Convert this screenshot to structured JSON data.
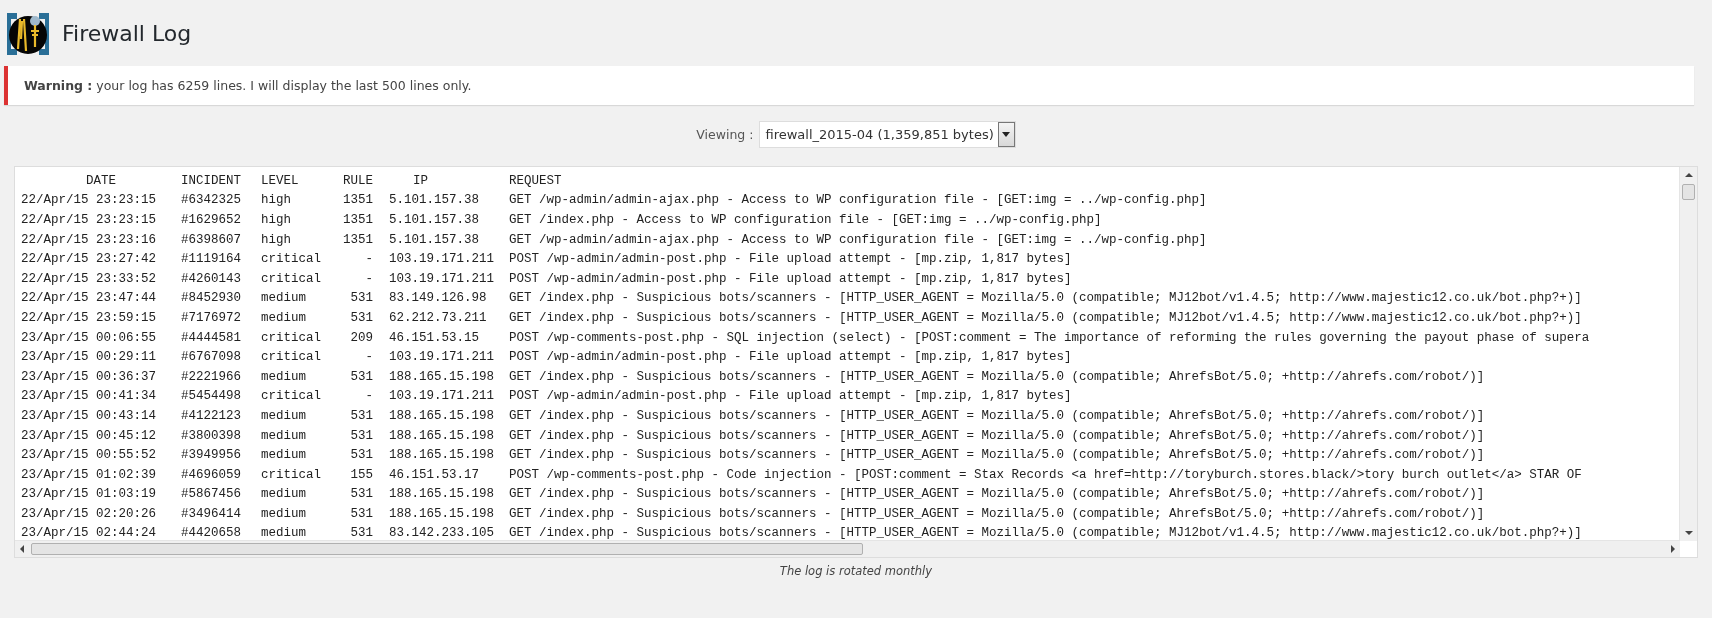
{
  "page": {
    "title": "Firewall Log"
  },
  "notice": {
    "label": "Warning :",
    "text": "your log has 6259 lines. I will display the last 500 lines only."
  },
  "viewer": {
    "label": "Viewing :",
    "value": "firewall_2015-04 (1,359,851 bytes)"
  },
  "log": {
    "columns": [
      "DATE",
      "INCIDENT",
      "LEVEL",
      "RULE",
      "IP",
      "REQUEST"
    ],
    "rows": [
      {
        "date": "22/Apr/15 23:23:15",
        "incident": "#6342325",
        "level": "high",
        "rule": "1351",
        "ip": "5.101.157.38",
        "request": "GET /wp-admin/admin-ajax.php - Access to WP configuration file - [GET:img = ../wp-config.php]"
      },
      {
        "date": "22/Apr/15 23:23:15",
        "incident": "#1629652",
        "level": "high",
        "rule": "1351",
        "ip": "5.101.157.38",
        "request": "GET /index.php - Access to WP configuration file - [GET:img = ../wp-config.php]"
      },
      {
        "date": "22/Apr/15 23:23:16",
        "incident": "#6398607",
        "level": "high",
        "rule": "1351",
        "ip": "5.101.157.38",
        "request": "GET /wp-admin/admin-ajax.php - Access to WP configuration file - [GET:img = ../wp-config.php]"
      },
      {
        "date": "22/Apr/15 23:27:42",
        "incident": "#1119164",
        "level": "critical",
        "rule": "-",
        "ip": "103.19.171.211",
        "request": "POST /wp-admin/admin-post.php - File upload attempt - [mp.zip, 1,817 bytes]"
      },
      {
        "date": "22/Apr/15 23:33:52",
        "incident": "#4260143",
        "level": "critical",
        "rule": "-",
        "ip": "103.19.171.211",
        "request": "POST /wp-admin/admin-post.php - File upload attempt - [mp.zip, 1,817 bytes]"
      },
      {
        "date": "22/Apr/15 23:47:44",
        "incident": "#8452930",
        "level": "medium",
        "rule": "531",
        "ip": "83.149.126.98",
        "request": "GET /index.php - Suspicious bots/scanners - [HTTP_USER_AGENT = Mozilla/5.0 (compatible; MJ12bot/v1.4.5; http://www.majestic12.co.uk/bot.php?+)]"
      },
      {
        "date": "22/Apr/15 23:59:15",
        "incident": "#7176972",
        "level": "medium",
        "rule": "531",
        "ip": "62.212.73.211",
        "request": "GET /index.php - Suspicious bots/scanners - [HTTP_USER_AGENT = Mozilla/5.0 (compatible; MJ12bot/v1.4.5; http://www.majestic12.co.uk/bot.php?+)]"
      },
      {
        "date": "23/Apr/15 00:06:55",
        "incident": "#4444581",
        "level": "critical",
        "rule": "209",
        "ip": "46.151.53.15",
        "request": "POST /wp-comments-post.php - SQL injection (select) - [POST:comment = The importance of reforming the rules governing the payout phase of supera"
      },
      {
        "date": "23/Apr/15 00:29:11",
        "incident": "#6767098",
        "level": "critical",
        "rule": "-",
        "ip": "103.19.171.211",
        "request": "POST /wp-admin/admin-post.php - File upload attempt - [mp.zip, 1,817 bytes]"
      },
      {
        "date": "23/Apr/15 00:36:37",
        "incident": "#2221966",
        "level": "medium",
        "rule": "531",
        "ip": "188.165.15.198",
        "request": "GET /index.php - Suspicious bots/scanners - [HTTP_USER_AGENT = Mozilla/5.0 (compatible; AhrefsBot/5.0; +http://ahrefs.com/robot/)]"
      },
      {
        "date": "23/Apr/15 00:41:34",
        "incident": "#5454498",
        "level": "critical",
        "rule": "-",
        "ip": "103.19.171.211",
        "request": "POST /wp-admin/admin-post.php - File upload attempt - [mp.zip, 1,817 bytes]"
      },
      {
        "date": "23/Apr/15 00:43:14",
        "incident": "#4122123",
        "level": "medium",
        "rule": "531",
        "ip": "188.165.15.198",
        "request": "GET /index.php - Suspicious bots/scanners - [HTTP_USER_AGENT = Mozilla/5.0 (compatible; AhrefsBot/5.0; +http://ahrefs.com/robot/)]"
      },
      {
        "date": "23/Apr/15 00:45:12",
        "incident": "#3800398",
        "level": "medium",
        "rule": "531",
        "ip": "188.165.15.198",
        "request": "GET /index.php - Suspicious bots/scanners - [HTTP_USER_AGENT = Mozilla/5.0 (compatible; AhrefsBot/5.0; +http://ahrefs.com/robot/)]"
      },
      {
        "date": "23/Apr/15 00:55:52",
        "incident": "#3949956",
        "level": "medium",
        "rule": "531",
        "ip": "188.165.15.198",
        "request": "GET /index.php - Suspicious bots/scanners - [HTTP_USER_AGENT = Mozilla/5.0 (compatible; AhrefsBot/5.0; +http://ahrefs.com/robot/)]"
      },
      {
        "date": "23/Apr/15 01:02:39",
        "incident": "#4696059",
        "level": "critical",
        "rule": "155",
        "ip": "46.151.53.17",
        "request": "POST /wp-comments-post.php - Code injection - [POST:comment = Stax Records <a href=http://toryburch.stores.black/>tory burch outlet</a> STAR OF"
      },
      {
        "date": "23/Apr/15 01:03:19",
        "incident": "#5867456",
        "level": "medium",
        "rule": "531",
        "ip": "188.165.15.198",
        "request": "GET /index.php - Suspicious bots/scanners - [HTTP_USER_AGENT = Mozilla/5.0 (compatible; AhrefsBot/5.0; +http://ahrefs.com/robot/)]"
      },
      {
        "date": "23/Apr/15 02:20:26",
        "incident": "#3496414",
        "level": "medium",
        "rule": "531",
        "ip": "188.165.15.198",
        "request": "GET /index.php - Suspicious bots/scanners - [HTTP_USER_AGENT = Mozilla/5.0 (compatible; AhrefsBot/5.0; +http://ahrefs.com/robot/)]"
      },
      {
        "date": "23/Apr/15 02:44:24",
        "incident": "#4420658",
        "level": "medium",
        "rule": "531",
        "ip": "83.142.233.105",
        "request": "GET /index.php - Suspicious bots/scanners - [HTTP_USER_AGENT = Mozilla/5.0 (compatible; MJ12bot/v1.4.5; http://www.majestic12.co.uk/bot.php?+)]"
      }
    ]
  },
  "footer": {
    "note": "The log is rotated monthly"
  }
}
